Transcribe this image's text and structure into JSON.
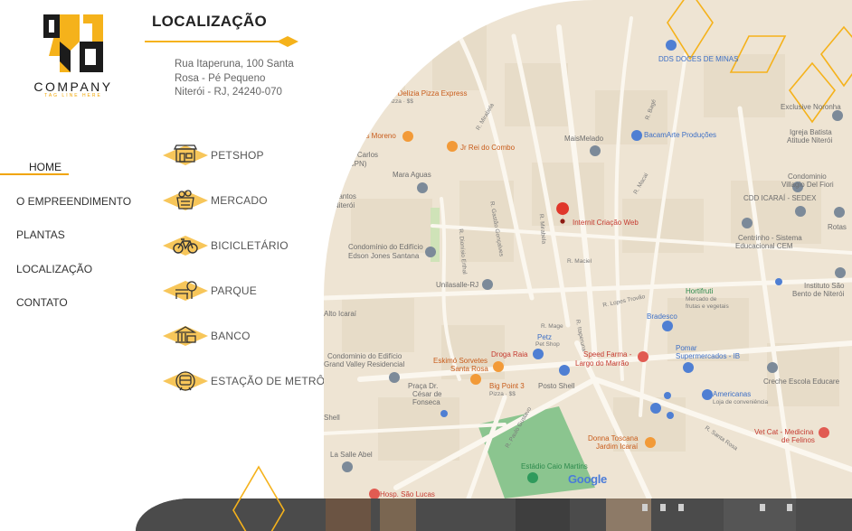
{
  "logo": {
    "brand": "COMPANY",
    "tagline": "TAG LINE HERE",
    "accent": "#f5b21b",
    "dark": "#1c1c1c"
  },
  "nav": {
    "items": [
      {
        "label": "HOME",
        "active": true
      },
      {
        "label": "O EMPREENDIMENTO",
        "active": false
      },
      {
        "label": "PLANTAS",
        "active": false
      },
      {
        "label": "LOCALIZAÇÃO",
        "active": false
      },
      {
        "label": "CONTATO",
        "active": false
      }
    ]
  },
  "location": {
    "title": "LOCALIZAÇÃO",
    "address": [
      "Rua Itaperuna, 100 Santa",
      "Rosa - Pé Pequeno",
      "Niterói - RJ, 24240-070"
    ]
  },
  "pois": [
    {
      "label": "PETSHOP",
      "icon": "petshop-icon"
    },
    {
      "label": "MERCADO",
      "icon": "market-icon"
    },
    {
      "label": "BICICLETÁRIO",
      "icon": "bicycle-icon"
    },
    {
      "label": "PARQUE",
      "icon": "park-icon"
    },
    {
      "label": "BANCO",
      "icon": "bank-icon"
    },
    {
      "label": "ESTAÇÃO DE METRÔ",
      "icon": "metro-icon"
    }
  ],
  "map": {
    "labels": {
      "dds": "DDS DOCES DE MINAS",
      "exclusive": "Exclusive Noronha",
      "igreja": "Igreja Batista",
      "atitude": "Atitude Niterói",
      "pizza_express": "La-Delizia Pizza Express",
      "pizza_sub": "Pizza · $$",
      "moreno": "cus Moreno",
      "rei_combo": "Jr Rei do Combo",
      "mais_melado": "MaisMelado",
      "bacamarte": "BacamArte Produções",
      "municipal": "nicipal Carlos",
      "municipal2": "igo CPN)",
      "mara_aguas": "Mara Aguas",
      "santos": "Santos",
      "niteroi": "Niterói",
      "internit": "Internit Criação Web",
      "condominio_villagio": "Condominio",
      "condominio_villagio2": "Villagio Del Fiori",
      "cdd": "CDD ICARAÍ - SEDEX",
      "centrinho": "Centrinho - Sistema",
      "centrinho2": "Educacional CEM",
      "rotas": "Rotas",
      "condominio_edson": "Condomínio do Edifício",
      "condominio_edson2": "Edson Jones Santana",
      "unilassalle": "Unilasalle-RJ",
      "instituto": "Instituto São",
      "instituto2": "Bento de Niterói",
      "hortifruti": "Hortifruti",
      "hortifruti2": "Mercado de",
      "hortifruti3": "frutas e vegetais",
      "alto_icarai": "Alto Icaraí",
      "bradesco": "Bradesco",
      "petz": "Petz",
      "petz2": "Pet Shop",
      "pomar": "Pomar",
      "pomar2": "Supermercados - IB",
      "condominio_grand": "Condominio do Edifício",
      "condominio_grand2": "Grand Valley Residencial",
      "droga_raia": "Droga Raia",
      "speed_farma": "Speed Farma -",
      "speed_farma2": "Largo do Marrão",
      "eskimo": "Eskimó Sorvetes",
      "eskimo2": "Santa Rosa",
      "creche": "Creche Escola Educare",
      "big_point": "Big Point 3",
      "big_point2": "Pizza · $$",
      "posto": "Posto Shell",
      "praca": "Praça Dr.",
      "praca2": "César de",
      "praca3": "Fonseca",
      "americanas": "Americanas",
      "americanas2": "Loja de conveniência",
      "vet_cat": "Vet Cat - Medicina",
      "vet_cat2": "de Felinos",
      "shell": "Shell",
      "donna": "Donna Toscana",
      "donna2": "Jardim Icaraí",
      "la_salle": "La Salle Abel",
      "estadio": "Estádio Caio Martins",
      "hosp": "Hosp. São Lucas",
      "google": "Google"
    },
    "streets": [
      "R. Mirabela",
      "R. Maciel",
      "R. Gastão Gonçalves",
      "R. Dionísio Erthal",
      "R. Mage",
      "R. Itaperuna",
      "R. Santa Rosa",
      "R. Lopes Trovão",
      "R. Paulo Gustavo",
      "R. Macai",
      "R. Bagé"
    ]
  },
  "colors": {
    "accent": "#f5b21b",
    "map_bg": "#efe6d6",
    "map_road": "#fbf7ef",
    "map_park": "#8bc58f"
  }
}
